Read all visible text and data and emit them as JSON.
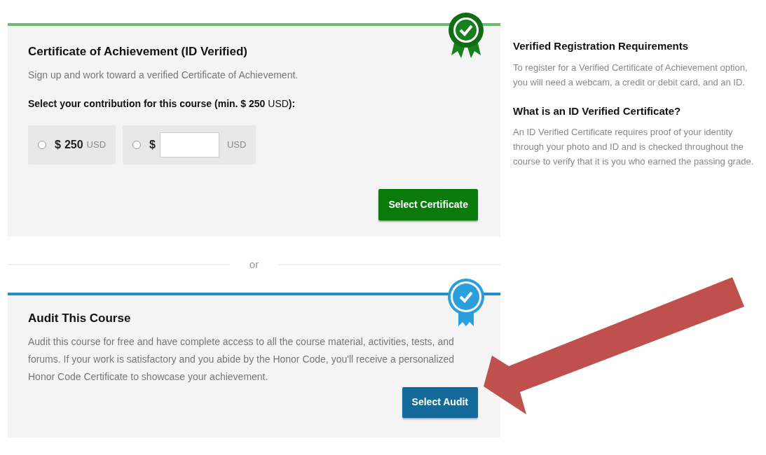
{
  "certificate_card": {
    "title": "Certificate of Achievement (ID Verified)",
    "description": "Sign up and work toward a verified Certificate of Achievement.",
    "contribution_label": "**Select your contribution for this course (min. $ 250** USD**):**",
    "options": [
      {
        "kind": "fixed",
        "selected": false,
        "currency_symbol": "$",
        "amount": "250",
        "currency": "USD"
      },
      {
        "kind": "custom",
        "selected": false,
        "currency_symbol": "$",
        "currency": "USD"
      }
    ],
    "button": "Select Certificate"
  },
  "divider": "or",
  "audit_card": {
    "title": "Audit This Course",
    "description": "Audit this course for free and have complete access to all the course material, activities, tests, and forums. If your work is satisfactory and you abide by the Honor Code, you'll receive a personalized Honor Code Certificate to showcase your achievement.",
    "button": "Select Audit"
  },
  "sidebar": [
    {
      "heading": "Verified Registration Requirements",
      "text": "To register for a Verified Certificate of Achievement option, you will need a webcam, a credit or debit card, and an ID."
    },
    {
      "heading": "What is an ID Verified Certificate?",
      "text": "An ID Verified Certificate requires proof of your identity through your photo and ID and is checked throughout the course to verify that it is you who earned the passing grade."
    }
  ]
}
